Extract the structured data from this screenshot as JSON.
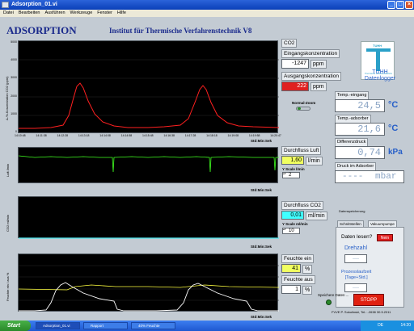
{
  "window": {
    "title": "Adsorption_01.vi",
    "menu": [
      "Datei",
      "Bearbeiten",
      "Ausführen",
      "Werkzeuge",
      "Fenster",
      "Hilfe"
    ]
  },
  "header": {
    "app_title": "ADSORPTION",
    "institute": "Institut für Thermische Verfahrenstechnik V8"
  },
  "charts": {
    "time_ticks": [
      "14:10:48",
      "14:11:38",
      "14:12:28",
      "14:13:18",
      "14:14:08",
      "14:14:58",
      "14:15:48",
      "14:16:38",
      "14:17:28",
      "14:18:18",
      "14:19:08",
      "14:19:58",
      "14:20:47"
    ],
    "xaxis_label": "Std:Min:Sek",
    "co2": {
      "ylabel": "Δ-%-Konzentration CO2 (ppm)",
      "yticks": [
        "5000",
        "4500",
        "4000",
        "3500",
        "3000",
        "2500",
        "2000",
        "1500",
        "1000",
        "500",
        "0"
      ],
      "color": "#ff2020"
    },
    "luft": {
      "ylabel": "Luft l/min",
      "yticks": [
        "2",
        "1,5",
        "1",
        "0,5",
        "0"
      ],
      "color": "#40ff20"
    },
    "co2_flow": {
      "ylabel": "CO2 ml/min",
      "yticks": [
        "10",
        "8",
        "6",
        "4",
        "2",
        "0"
      ],
      "color": "#00ffff"
    },
    "feuchte": {
      "ylabel": "Feuchte ein / aus %",
      "yticks": [
        "100",
        "80",
        "60",
        "40",
        "20",
        "0"
      ],
      "color_in": "#ffff40",
      "color_out": "#ffffff"
    }
  },
  "right": {
    "co2_label": "CO2",
    "eingang_label": "Eingangskonzentration",
    "eingang_value": "-1247",
    "ppm": "ppm",
    "ausgang_label": "Ausgangskonzentration",
    "ausgang_value": "222",
    "normal_zoom": "Normal-Zoom",
    "durchfluss_luft_label": "Durchfluss Luft",
    "durchfluss_luft_value": "1,60",
    "lmin": "l/min",
    "yscale_lmin": "Y Scale l/min",
    "yscale_lmin_value": "2",
    "durchfluss_co2_label": "Durchfluss CO2",
    "durchfluss_co2_value": "0,01",
    "mlmin": "ml/min",
    "yscale_mlmin": "Y Scale ml/min",
    "yscale_mlmin_value": "10",
    "feuchte_ein_label": "Feuchte ein",
    "feuchte_ein_value": "41",
    "feuchte_aus_label": "Feuchte aus",
    "feuchte_aus_value": "1",
    "percent": "%"
  },
  "logger": {
    "tuhh_top": "TUHH",
    "tuhh_sub": "Thermische Verfahrenstechnik",
    "title_line1": "TUHH",
    "title_line2": "Datenlogger",
    "temp_eingang_label": "Temp.-eingang",
    "temp_eingang_value": "24,5",
    "temp_adsorber_label": "Temp.-adsorber",
    "temp_adsorber_value": "21,6",
    "deg_c": "°C",
    "differenzdruck_label": "Differenzdruck",
    "differenzdruck_value": "0,74",
    "kpa": "kPa",
    "druck_label": "Druck im Adsorber",
    "druck_value": "----",
    "mbar": "mbar"
  },
  "tabs": {
    "group": "Datenspeicherung",
    "tab1": "Schnittstellen",
    "tab2": "Vakuumpumpe",
    "daten_lesen": "Daten lesen?",
    "nein": "Nein",
    "drehzahl": "Drehzahl",
    "drehzahl_value": "----",
    "prozess_line1": "Prozesslaufzeit",
    "prozess_line2": "[Tage+Std.]",
    "prozess_value": "----"
  },
  "footer": {
    "speichere": "Speichere Daten ...",
    "stopp": "STOPP",
    "credit": "FVVE P. Sokolinski, Tel.: -2638 30.5.2011"
  },
  "taskbar": {
    "start": "Start",
    "tasks": [
      "Adsorption_01.vi",
      "Rapport",
      "40% Feuchte"
    ],
    "tray_lang": "DE",
    "clock": "14:20"
  }
}
